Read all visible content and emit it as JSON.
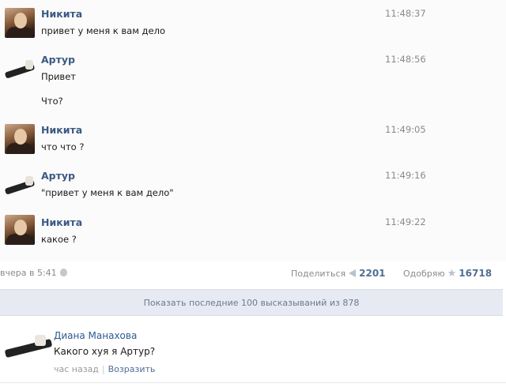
{
  "messages": [
    {
      "author": "Никита",
      "time": "11:48:37",
      "lines": [
        "привет у меня к вам дело"
      ],
      "avatar": "nikita-avatar"
    },
    {
      "author": "Артур",
      "time": "11:48:56",
      "lines": [
        "Привет",
        "Что?"
      ],
      "avatar": "artur-avatar"
    },
    {
      "author": "Никита",
      "time": "11:49:05",
      "lines": [
        "что что ?"
      ],
      "avatar": "nikita-avatar"
    },
    {
      "author": "Артур",
      "time": "11:49:16",
      "lines": [
        "\"привет у меня к вам дело\""
      ],
      "avatar": "artur-avatar"
    },
    {
      "author": "Никита",
      "time": "11:49:22",
      "lines": [
        "какое ?"
      ],
      "avatar": "nikita-avatar"
    }
  ],
  "post_meta": {
    "date": "вчера в 5:41",
    "share_label": "Поделиться",
    "share_count": "2201",
    "approve_label": "Одобряю",
    "approve_count": "16718"
  },
  "show_more": {
    "label": "Показать последние 100 высказываний из 878"
  },
  "reply": {
    "author": "Диана Манахова",
    "text": "Какого хуя я Артур?",
    "time": "час назад",
    "separator": "|",
    "action": "Возразить"
  },
  "colors": {
    "author_blue": "#3b5a83",
    "link_blue": "#4f6f94",
    "bar_bg": "#e7eaf2",
    "muted": "#8a8a8a"
  }
}
